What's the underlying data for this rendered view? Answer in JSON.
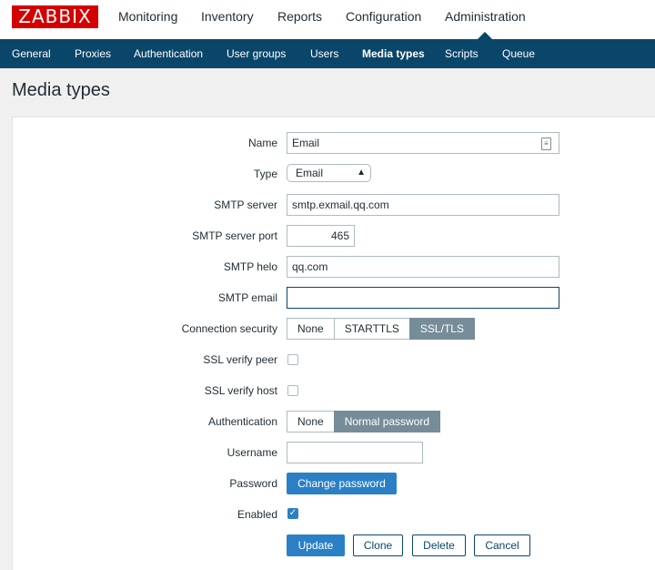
{
  "app": {
    "logo_text": "ZABBIX"
  },
  "main_menu": [
    "Monitoring",
    "Inventory",
    "Reports",
    "Configuration",
    "Administration"
  ],
  "sub_menu": [
    "General",
    "Proxies",
    "Authentication",
    "User groups",
    "Users",
    "Media types",
    "Scripts",
    "Queue"
  ],
  "page_title": "Media types",
  "form": {
    "name_label": "Name",
    "name_value": "Email",
    "type_label": "Type",
    "type_value": "Email",
    "smtp_server_label": "SMTP server",
    "smtp_server_value": "smtp.exmail.qq.com",
    "smtp_port_label": "SMTP server port",
    "smtp_port_value": "465",
    "smtp_helo_label": "SMTP helo",
    "smtp_helo_value": "qq.com",
    "smtp_email_label": "SMTP email",
    "smtp_email_value": "",
    "security_label": "Connection security",
    "security_options": [
      "None",
      "STARTTLS",
      "SSL/TLS"
    ],
    "security_selected": "SSL/TLS",
    "verify_peer_label": "SSL verify peer",
    "verify_host_label": "SSL verify host",
    "auth_label": "Authentication",
    "auth_options": [
      "None",
      "Normal password"
    ],
    "auth_selected": "Normal password",
    "username_label": "Username",
    "username_value": "",
    "password_label": "Password",
    "change_password_label": "Change password",
    "enabled_label": "Enabled"
  },
  "buttons": {
    "update": "Update",
    "clone": "Clone",
    "delete": "Delete",
    "cancel": "Cancel"
  },
  "colors": {
    "brand": "#d40000",
    "nav": "#0a466a",
    "primary": "#2b80c5",
    "segment_active": "#768d99"
  }
}
